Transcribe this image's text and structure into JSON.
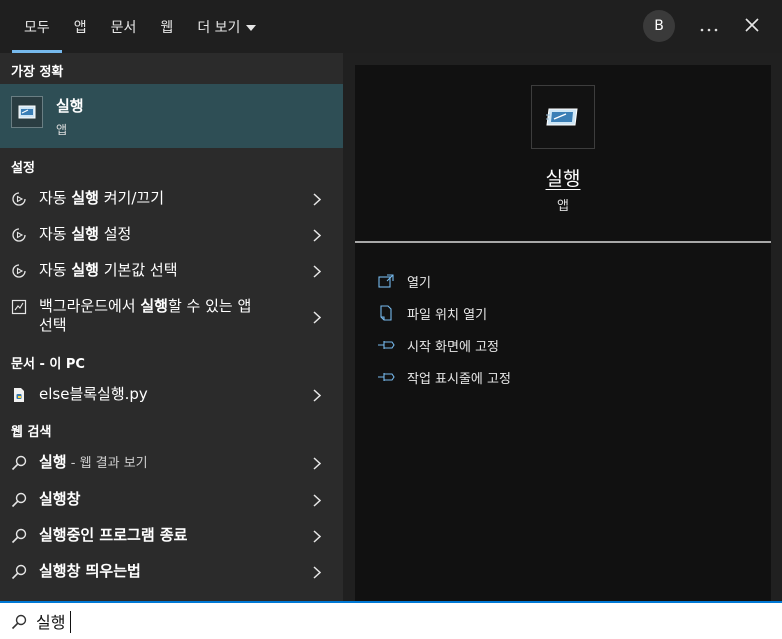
{
  "tabs": [
    {
      "label": "모두",
      "active": true
    },
    {
      "label": "앱"
    },
    {
      "label": "문서"
    },
    {
      "label": "웹"
    },
    {
      "label": "더 보기"
    }
  ],
  "header": {
    "avatar_letter": "B",
    "more_icon": "ellipsis-icon",
    "close_icon": "close-icon"
  },
  "best_match": {
    "section": "가장 정확",
    "title": "실행",
    "type": "앱"
  },
  "settings": {
    "section": "설정",
    "items": [
      {
        "pre": "자동 ",
        "bold": "실행",
        "post": " 켜기/끄기"
      },
      {
        "pre": "자동 ",
        "bold": "실행",
        "post": " 설정"
      },
      {
        "pre": "자동 ",
        "bold": "실행",
        "post": " 기본값 선택"
      },
      {
        "pre": "백그라운드에서 ",
        "bold": "실행",
        "post": "할 수 있는 앱",
        "line2": "선택"
      }
    ]
  },
  "documents": {
    "section": "문서 - 이 PC",
    "items": [
      {
        "label": "else블록실행.py"
      }
    ]
  },
  "web": {
    "section": "웹 검색",
    "items": [
      {
        "bold": "실행",
        "suffix": " - 웹 결과 보기"
      },
      {
        "bold": "실행",
        "rest": "창"
      },
      {
        "bold": "실행",
        "rest": "중인 프로그램 종료"
      },
      {
        "bold": "실행",
        "rest": "창 띄우는법"
      }
    ]
  },
  "detail": {
    "title": "실행",
    "type": "앱",
    "actions": [
      {
        "label": "열기",
        "icon": "open-icon"
      },
      {
        "label": "파일 위치 열기",
        "icon": "file-location-icon"
      },
      {
        "label": "시작 화면에 고정",
        "icon": "pin-icon"
      },
      {
        "label": "작업 표시줄에 고정",
        "icon": "pin-icon"
      }
    ]
  },
  "search": {
    "value": "실행",
    "placeholder": ""
  },
  "colors": {
    "accent": "#76b9ed",
    "selected_bg": "#2e4e55",
    "search_border": "#0078d4"
  }
}
